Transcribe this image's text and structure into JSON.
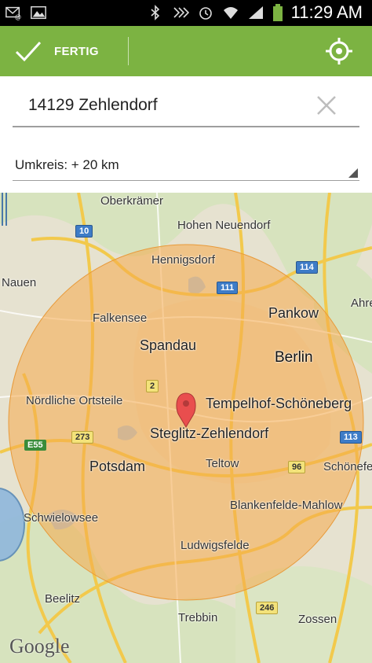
{
  "status_bar": {
    "time": "11:29 AM"
  },
  "action_bar": {
    "done_label": "FERTIG"
  },
  "location": {
    "value": "14129 Zehlendorf"
  },
  "radius": {
    "selected": "Umkreis: + 20 km"
  },
  "map": {
    "places": {
      "oberkraemer": "Oberkrämer",
      "hohen_neuendorf": "Hohen Neuendorf",
      "hennigsdorf": "Hennigsdorf",
      "nauen": "Nauen",
      "pankow": "Pankow",
      "ahre": "Ahre",
      "falkensee": "Falkensee",
      "spandau": "Spandau",
      "berlin": "Berlin",
      "tempelhof": "Tempelhof-Schöneberg",
      "noerdliche": "Nördliche Ortsteile",
      "steglitz": "Steglitz-Zehlendorf",
      "teltow": "Teltow",
      "potsdam": "Potsdam",
      "schoenefe": "Schönefe",
      "schwielowsee": "Schwielowsee",
      "blankenfelde": "Blankenfelde-Mahlow",
      "ludwigsfelde": "Ludwigsfelde",
      "beelitz": "Beelitz",
      "trebbin": "Trebbin",
      "zossen": "Zossen"
    },
    "roads": {
      "r10": "10",
      "r114": "114",
      "r111": "111",
      "r2": "2",
      "r273": "273",
      "re55": "E55",
      "r113": "113",
      "r96": "96",
      "r246": "246"
    },
    "attribution": "Google",
    "colors": {
      "radius_fill": "#f6a94a",
      "pin": "#e94e4e",
      "accent": "#7cb342"
    }
  }
}
